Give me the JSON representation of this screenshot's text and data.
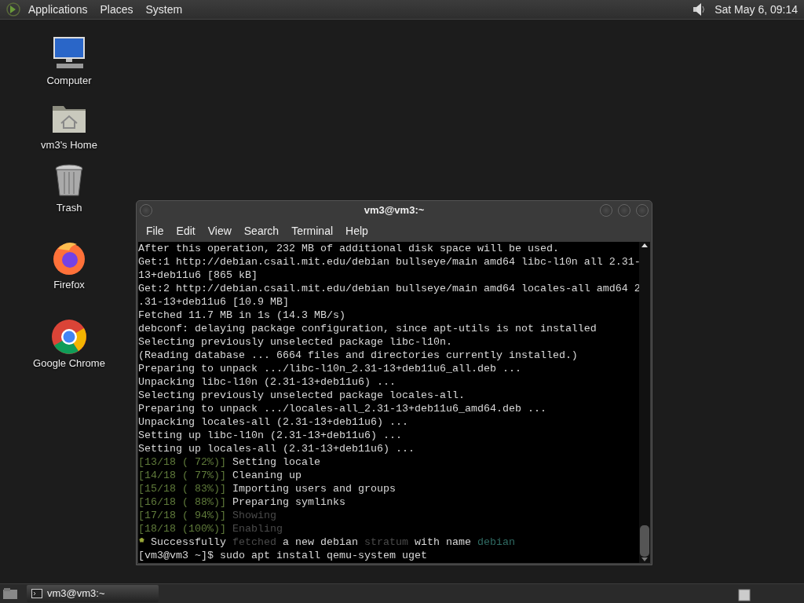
{
  "top_panel": {
    "menus": [
      "Applications",
      "Places",
      "System"
    ],
    "clock": "Sat May  6, 09:14"
  },
  "desktop_icons": [
    {
      "kind": "computer",
      "label": "Computer"
    },
    {
      "kind": "home",
      "label": "vm3's Home"
    },
    {
      "kind": "trash",
      "label": "Trash"
    },
    {
      "kind": "firefox",
      "label": "Firefox"
    },
    {
      "kind": "chrome",
      "label": "Google Chrome"
    }
  ],
  "terminal": {
    "title": "vm3@vm3:~",
    "menu": [
      "File",
      "Edit",
      "View",
      "Search",
      "Terminal",
      "Help"
    ],
    "lines": [
      [
        {
          "text": "After this operation, 232 MB of additional disk space will be used."
        }
      ],
      [
        {
          "text": "Get:1 http://debian.csail.mit.edu/debian bullseye/main amd64 libc-l10n all 2.31-"
        }
      ],
      [
        {
          "text": "13+deb11u6 [865 kB]"
        }
      ],
      [
        {
          "text": "Get:2 http://debian.csail.mit.edu/debian bullseye/main amd64 locales-all amd64 2"
        }
      ],
      [
        {
          "text": ".31-13+deb11u6 [10.9 MB]"
        }
      ],
      [
        {
          "text": "Fetched 11.7 MB in 1s (14.3 MB/s)"
        }
      ],
      [
        {
          "text": "debconf: delaying package configuration, since apt-utils is not installed"
        }
      ],
      [
        {
          "text": "Selecting previously unselected package libc-l10n."
        }
      ],
      [
        {
          "text": "(Reading database ... 6664 files and directories currently installed.)"
        }
      ],
      [
        {
          "text": "Preparing to unpack .../libc-l10n_2.31-13+deb11u6_all.deb ..."
        }
      ],
      [
        {
          "text": "Unpacking libc-l10n (2.31-13+deb11u6) ..."
        }
      ],
      [
        {
          "text": "Selecting previously unselected package locales-all."
        }
      ],
      [
        {
          "text": "Preparing to unpack .../locales-all_2.31-13+deb11u6_amd64.deb ..."
        }
      ],
      [
        {
          "text": "Unpacking locales-all (2.31-13+deb11u6) ..."
        }
      ],
      [
        {
          "text": "Setting up libc-l10n (2.31-13+deb11u6) ..."
        }
      ],
      [
        {
          "text": "Setting up locales-all (2.31-13+deb11u6) ..."
        }
      ],
      [
        {
          "text": "[13/18 ( 72%)]",
          "color": "#5f7a3a"
        },
        {
          "text": " Setting locale"
        }
      ],
      [
        {
          "text": "[14/18 ( 77%)]",
          "color": "#5f7a3a"
        },
        {
          "text": " Cleaning up"
        }
      ],
      [
        {
          "text": "[15/18 ( 83%)]",
          "color": "#5f7a3a"
        },
        {
          "text": " Importing users and groups"
        }
      ],
      [
        {
          "text": "[16/18 ( 88%)]",
          "color": "#5f7a3a"
        },
        {
          "text": " Preparing symlinks"
        }
      ],
      [
        {
          "text": "[17/18 ( 94%)]",
          "color": "#5f7a3a"
        },
        {
          "text": " Showing",
          "color": "#4a4a4a"
        }
      ],
      [
        {
          "text": "[18/18 (100%)]",
          "color": "#5f7a3a"
        },
        {
          "text": " Enabling",
          "color": "#4a4a4a"
        }
      ],
      [
        {
          "text": "*",
          "color": "#9aa83a"
        },
        {
          "text": " Successfully "
        },
        {
          "text": "fetched",
          "color": "#4a4a4a"
        },
        {
          "text": " a new debian "
        },
        {
          "text": "stratum",
          "color": "#4a4a4a"
        },
        {
          "text": " with name "
        },
        {
          "text": "debian",
          "color": "#2f6b63"
        }
      ],
      [
        {
          "text": "[vm3@vm3 ~]$ sudo apt install qemu-system uget"
        }
      ]
    ]
  },
  "taskbar": {
    "tasks": [
      {
        "label": "vm3@vm3:~",
        "selected": true
      }
    ]
  }
}
